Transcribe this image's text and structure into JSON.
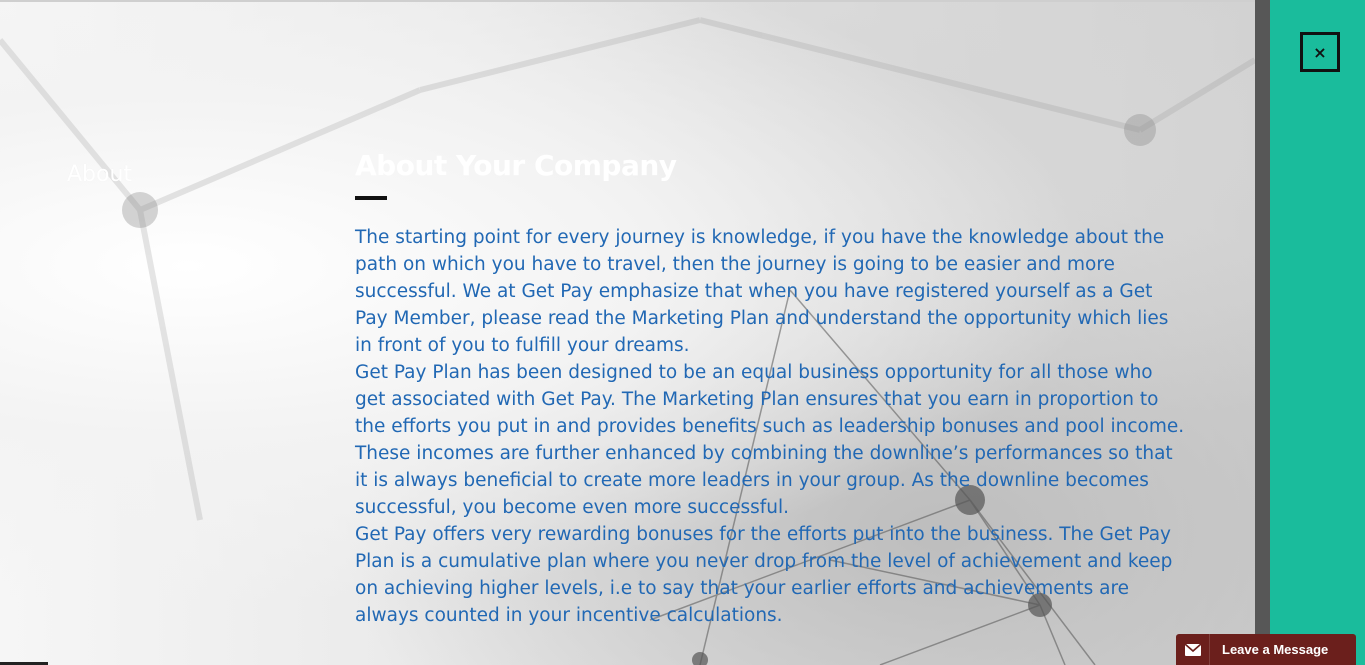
{
  "sidebar": {
    "label": "About"
  },
  "main": {
    "title": "About Your Company",
    "paragraphs": [
      "The starting point for every journey is knowledge, if you have the knowledge about the path on which you have to travel, then the journey is going to be easier and more successful. We at Get Pay emphasize that when you have registered yourself as a Get Pay Member, please read the Marketing Plan and understand the opportunity which lies in front of you to fulfill your dreams.",
      "Get Pay Plan has been designed to be an equal business opportunity for all those who get associated with Get Pay. The Marketing Plan ensures that you earn in proportion to the efforts you put in and provides benefits such as leadership bonuses and pool income. These incomes are further enhanced by combining the downline’s performances so that it is always beneficial to create more leaders in your group. As the downline becomes successful, you become even more successful.",
      "Get Pay offers very rewarding bonuses for the efforts put into the business. The Get Pay Plan is a cumulative plan where you never drop from the level of achievement and keep on achieving higher levels, i.e to say that your earlier efforts and achievements are always counted in your incentive calculations."
    ]
  },
  "panel": {
    "close_label": "×",
    "close_icon": "close-icon",
    "accent_color": "#1abc9c"
  },
  "chat_widget": {
    "label": "Leave a Message",
    "icon": "mail-icon",
    "color": "#6b1f1c"
  },
  "colors": {
    "body_text": "#2168b4",
    "title": "#ffffff"
  }
}
